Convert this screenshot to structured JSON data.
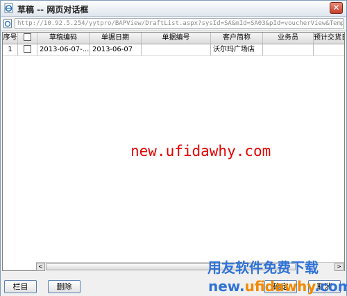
{
  "window": {
    "title": "草稿  --  网页对话框",
    "close_symbol": "✕",
    "address": "http://10.92.5.254/yytpro/BAPView/DraftList.aspx?sysId=SA&mId=SA03&pId=voucherView&TemplateNam-"
  },
  "grid": {
    "columns": [
      "序号",
      "",
      "草稿编码",
      "单据日期",
      "单据编号",
      "客户简称",
      "业务员",
      "预计交货日"
    ],
    "rows": [
      {
        "seq": "1",
        "draft_code": "2013-06-07-...",
        "date": "2013-06-07",
        "doc_no": "",
        "customer": "沃尔玛广场店",
        "salesman": "",
        "delivery": ""
      }
    ]
  },
  "scroll": {
    "left": "<",
    "right": ">"
  },
  "buttons": {
    "columns": "栏目",
    "delete": "删除",
    "ok": "确定",
    "cancel": "取消"
  },
  "watermarks": {
    "url_text": "new.ufidawhy.com",
    "brand_cn": "用友软件免费下载",
    "brand_url_a": "new.",
    "brand_url_b": "ufidawhy",
    "brand_url_c": ".com"
  },
  "colors": {
    "watermark_red": "#e60000",
    "brand_blue": "#2f72d6",
    "brand_orange": "#f08a00"
  },
  "icons": {
    "title": "ie-page-icon",
    "address": "ie-page-icon",
    "close": "close-icon"
  }
}
